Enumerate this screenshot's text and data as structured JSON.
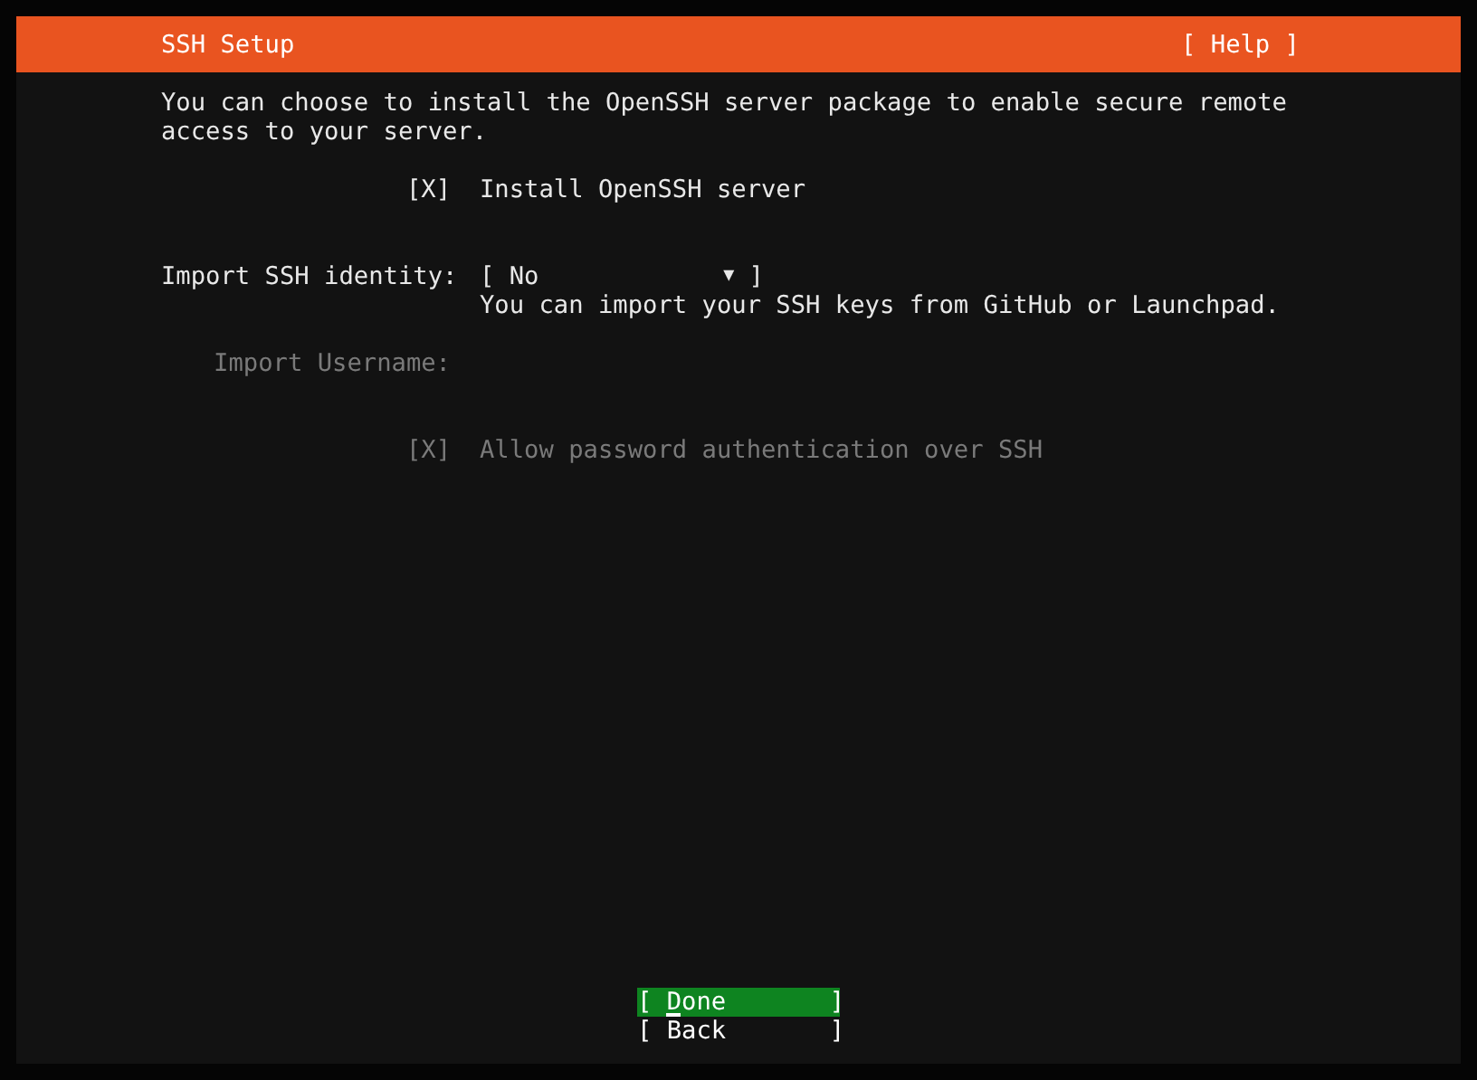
{
  "header": {
    "title": "SSH Setup",
    "help": "[ Help ]"
  },
  "description": "You can choose to install the OpenSSH server package to enable secure remote access to your server.",
  "rows": [
    {
      "kind": "checkbox",
      "box": "[X]",
      "checked": true,
      "label": "Install OpenSSH server",
      "disabled": false
    },
    {
      "kind": "dropdown",
      "label": "Import SSH identity:",
      "open": "[",
      "value": "No",
      "arrow": "▼",
      "close": "]",
      "hint": "You can import your SSH keys from GitHub or Launchpad.",
      "disabled": false
    },
    {
      "kind": "field",
      "label": "Import Username:",
      "disabled": true
    },
    {
      "kind": "checkbox",
      "box": "[X]",
      "checked": true,
      "label": "Allow password authentication over SSH",
      "disabled": true
    }
  ],
  "buttons": [
    {
      "label": "[ Done       ]",
      "selected": true
    },
    {
      "label": "[ Back       ]",
      "selected": false
    }
  ]
}
